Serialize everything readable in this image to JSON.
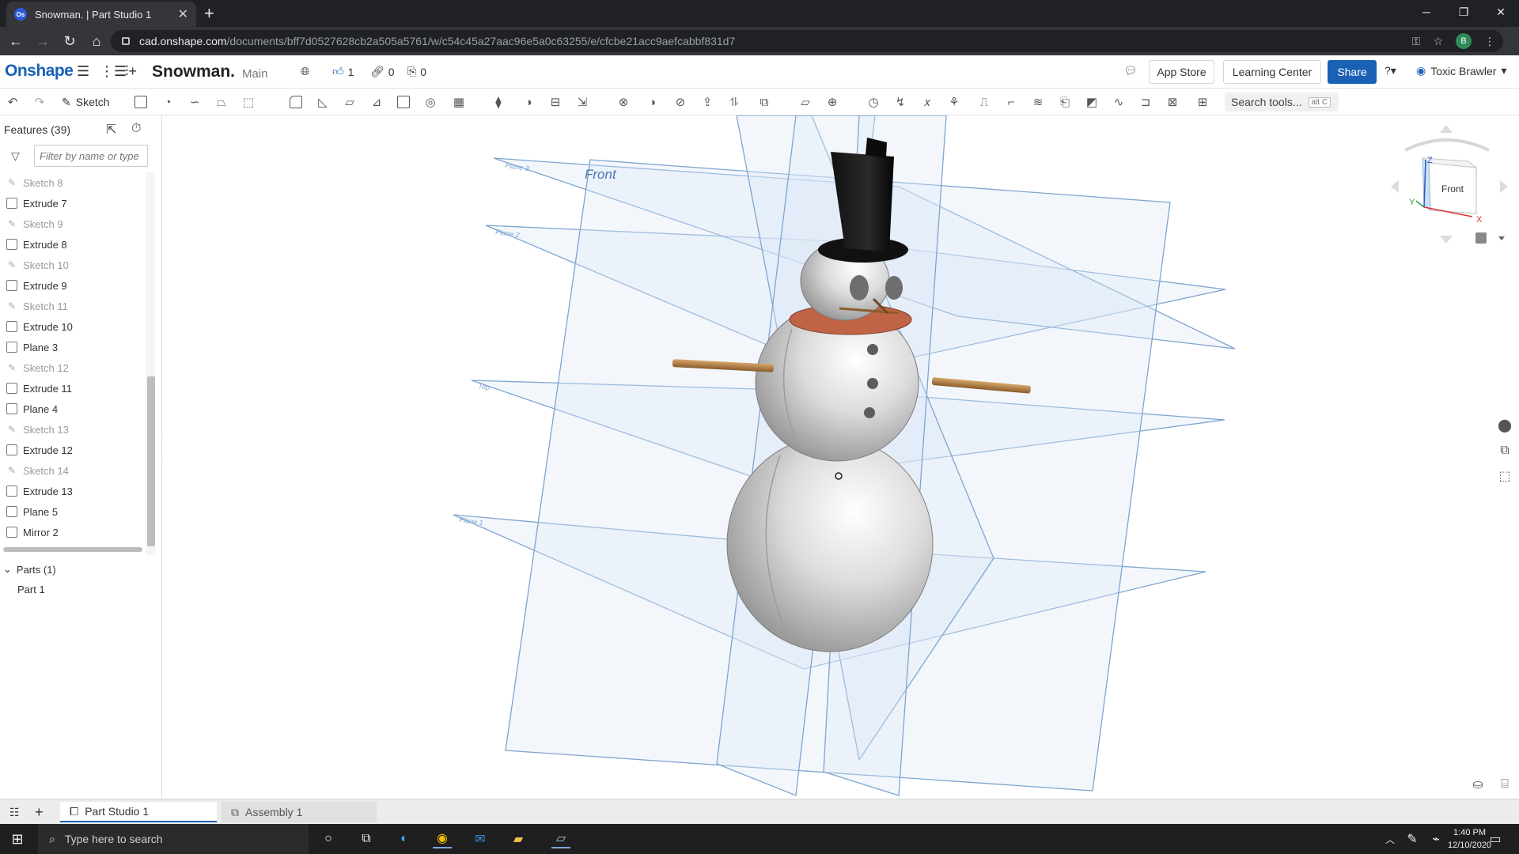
{
  "browser": {
    "tab_title": "Snowman. | Part Studio 1",
    "tab_favicon": "Os",
    "url_host": "cad.onshape.com",
    "url_path": "/documents/bff7d0527628cb2a505a5761/w/c54c45a27aac96e5a0c63255/e/cfcbe21acc9aefcabbf831d7",
    "profile_initial": "B"
  },
  "header": {
    "logo": "Onshape",
    "doc_title": "Snowman.",
    "workspace": "Main",
    "likes": "1",
    "links": "0",
    "copies": "0",
    "app_store": "App Store",
    "learning_center": "Learning Center",
    "share": "Share",
    "user_name": "Toxic Brawler"
  },
  "toolbar": {
    "sketch_label": "Sketch",
    "search_placeholder": "Search tools...",
    "search_shortcut": "alt C"
  },
  "features": {
    "header": "Features (39)",
    "filter_placeholder": "Filter by name or type",
    "items": [
      {
        "label": "Sketch 8",
        "type": "sketch"
      },
      {
        "label": "Extrude 7",
        "type": "extrude"
      },
      {
        "label": "Sketch 9",
        "type": "sketch"
      },
      {
        "label": "Extrude 8",
        "type": "extrude"
      },
      {
        "label": "Sketch 10",
        "type": "sketch"
      },
      {
        "label": "Extrude 9",
        "type": "extrude"
      },
      {
        "label": "Sketch 11",
        "type": "sketch"
      },
      {
        "label": "Extrude 10",
        "type": "extrude"
      },
      {
        "label": "Plane 3",
        "type": "plane"
      },
      {
        "label": "Sketch 12",
        "type": "sketch"
      },
      {
        "label": "Extrude 11",
        "type": "extrude"
      },
      {
        "label": "Plane 4",
        "type": "plane"
      },
      {
        "label": "Sketch 13",
        "type": "sketch"
      },
      {
        "label": "Extrude 12",
        "type": "extrude"
      },
      {
        "label": "Sketch 14",
        "type": "sketch"
      },
      {
        "label": "Extrude 13",
        "type": "extrude"
      },
      {
        "label": "Plane 5",
        "type": "plane"
      },
      {
        "label": "Mirror 2",
        "type": "mirror"
      }
    ],
    "parts_header": "Parts (1)",
    "parts": [
      "Part 1"
    ]
  },
  "viewport": {
    "plane_labels": [
      "Front",
      "Plane 3",
      "Plane 2",
      "Top",
      "Plane 1"
    ],
    "view_cube_label": "Front",
    "axes": {
      "x": "X",
      "y": "Y",
      "z": "Z"
    }
  },
  "tabs": {
    "part_studio": "Part Studio 1",
    "assembly": "Assembly 1"
  },
  "taskbar": {
    "search_placeholder": "Type here to search",
    "time": "1:40 PM",
    "date": "12/10/2020"
  },
  "colors": {
    "onshape_blue": "#1a60b4",
    "plane_fill": "#dce8f4",
    "plane_stroke": "#7da4cf",
    "scarf": "#b5553f",
    "arm": "#b8874f"
  }
}
